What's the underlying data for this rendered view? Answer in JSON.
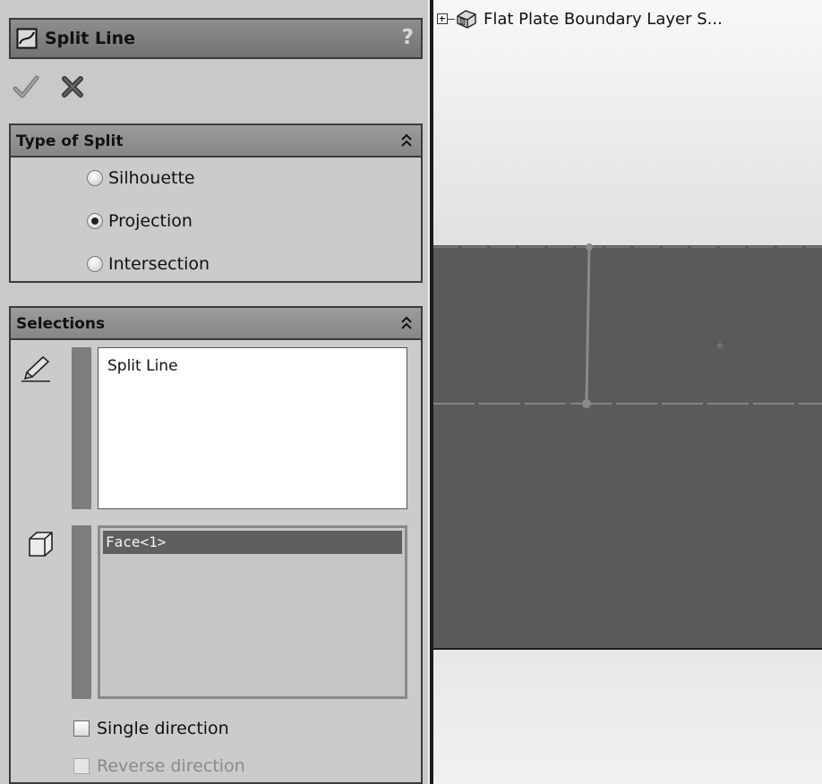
{
  "panel": {
    "title": "Split Line",
    "help": "?"
  },
  "type_of_split": {
    "header": "Type of Split",
    "options": [
      "Silhouette",
      "Projection",
      "Intersection"
    ],
    "selected": "Projection"
  },
  "selections": {
    "header": "Selections",
    "split_tool_label": "Split Line",
    "faces": [
      "Face<1>"
    ]
  },
  "options": {
    "single_direction": {
      "label": "Single direction",
      "checked": false
    },
    "reverse_direction": {
      "label": "Reverse direction",
      "checked": false,
      "enabled": false
    }
  },
  "feature_tree": {
    "item": "Flat Plate Boundary Layer S..."
  }
}
